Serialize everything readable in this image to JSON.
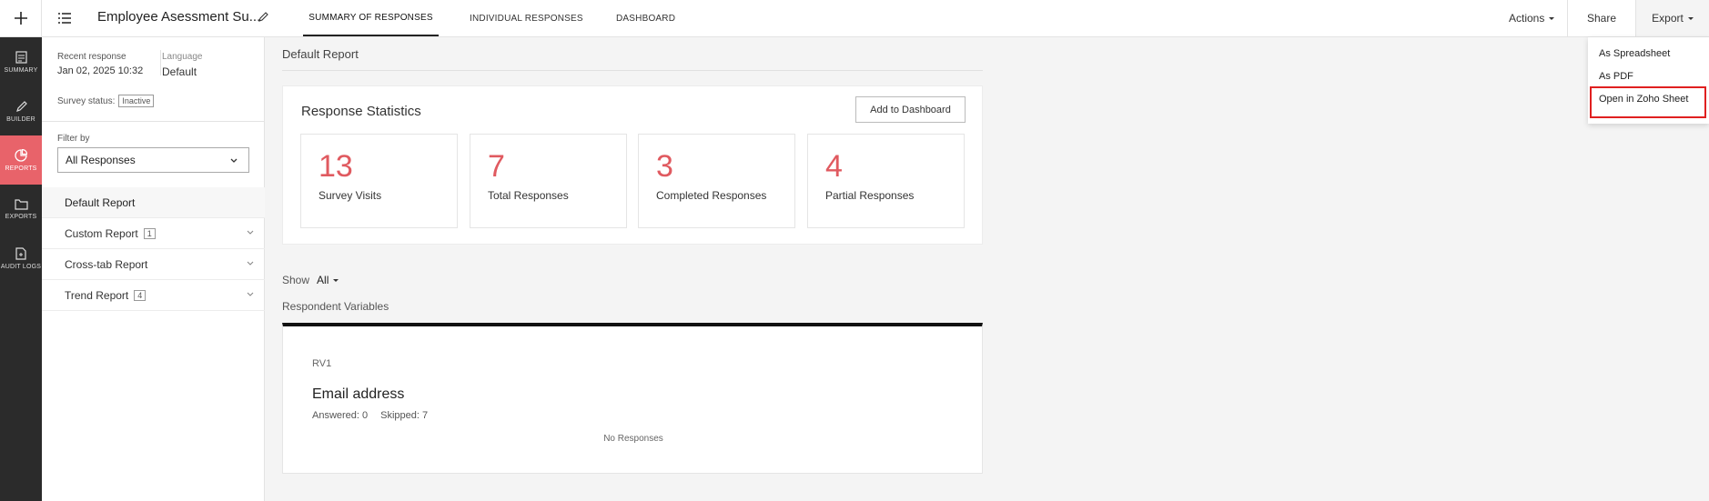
{
  "topbar": {
    "survey_title": "Employee Asessment Su...",
    "tabs": [
      {
        "label": "SUMMARY OF RESPONSES"
      },
      {
        "label": "INDIVIDUAL RESPONSES"
      },
      {
        "label": "DASHBOARD"
      }
    ],
    "actions_label": "Actions",
    "share_label": "Share",
    "export_label": "Export"
  },
  "leftnav": {
    "items": [
      {
        "label": "SUMMARY",
        "icon": "summary-icon"
      },
      {
        "label": "BUILDER",
        "icon": "pencil-icon"
      },
      {
        "label": "REPORTS",
        "icon": "pie-chart-icon"
      },
      {
        "label": "EXPORTS",
        "icon": "folder-icon"
      },
      {
        "label": "AUDIT LOGS",
        "icon": "document-icon"
      }
    ]
  },
  "sidepanel": {
    "recent_label": "Recent response",
    "recent_value": "Jan 02, 2025 10:32",
    "language_label": "Language",
    "language_value": "Default",
    "status_label": "Survey status:",
    "status_value": "Inactive",
    "filter_label": "Filter by",
    "filter_value": "All Responses",
    "reports": [
      {
        "label": "Default Report",
        "count": ""
      },
      {
        "label": "Custom Report",
        "count": "1"
      },
      {
        "label": "Cross-tab Report",
        "count": ""
      },
      {
        "label": "Trend Report",
        "count": "4"
      }
    ]
  },
  "main": {
    "title": "Default Report",
    "stats_title": "Response Statistics",
    "add_dashboard_label": "Add to Dashboard",
    "stats": [
      {
        "value": "13",
        "label": "Survey Visits"
      },
      {
        "value": "7",
        "label": "Total Responses"
      },
      {
        "value": "3",
        "label": "Completed Responses"
      },
      {
        "value": "4",
        "label": "Partial Responses"
      }
    ],
    "show_label": "Show",
    "show_value": "All",
    "rv_title": "Respondent Variables",
    "rv_card": {
      "code": "RV1",
      "question": "Email address",
      "answered": "Answered: 0",
      "skipped": "Skipped: 7",
      "empty_text": "No Responses"
    }
  },
  "export_menu": {
    "items": [
      {
        "label": "As Spreadsheet"
      },
      {
        "label": "As PDF"
      },
      {
        "label": "Open in Zoho Sheet"
      }
    ]
  },
  "colors": {
    "accent": "#e8636a",
    "stat_number": "#e05a60",
    "highlight": "#e02020",
    "nav_bg": "#2b2b2b"
  }
}
